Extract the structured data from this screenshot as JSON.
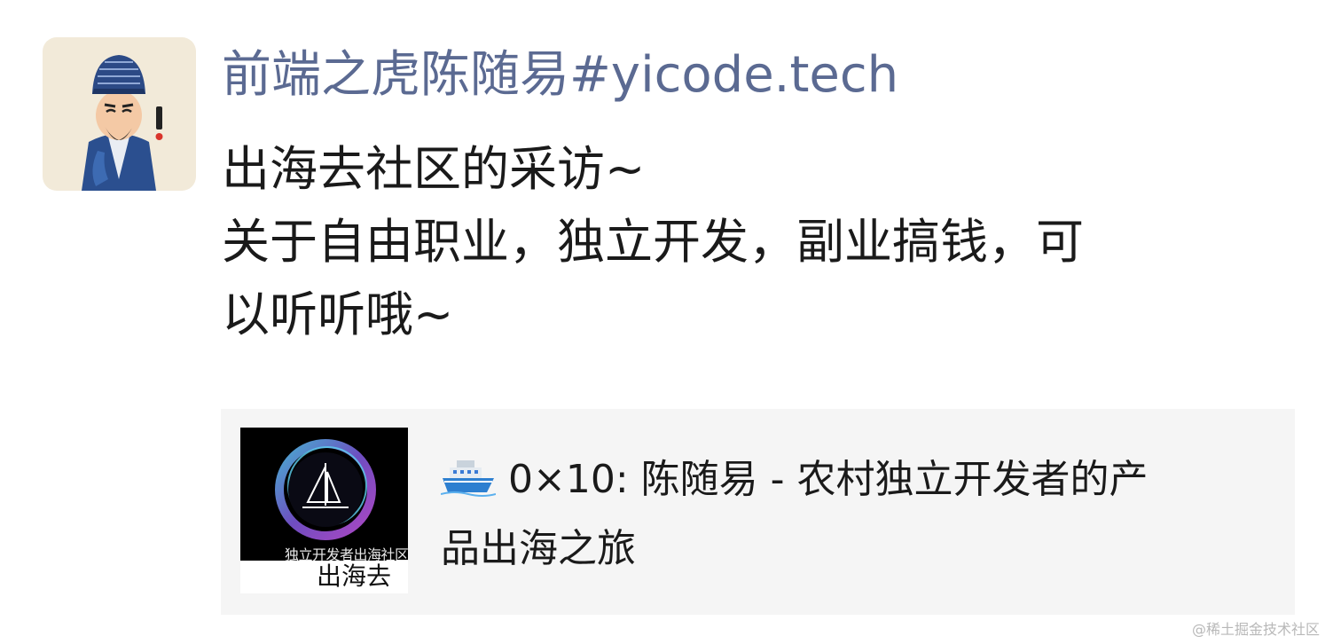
{
  "post": {
    "author": "前端之虎陈随易#yicode.tech",
    "avatar_icon": "cartoon-scholar-avatar",
    "message_lines": [
      "出海去社区的采访~",
      "关于自由职业，独立开发，副业搞钱，可",
      "以听听哦~"
    ]
  },
  "link_card": {
    "thumbnail": {
      "subtitle": "独立开发者出海社区",
      "label": "出海去",
      "icon": "sailboat-logo-icon"
    },
    "title_icon": "ship-emoji-icon",
    "title_lines": [
      "0×10: 陈随易 - 农村独立开发者的产",
      "品出海之旅"
    ]
  },
  "watermark": "@稀土掘金技术社区",
  "colors": {
    "author": "#5b6a92",
    "text": "#1a1a1a",
    "card_bg": "#f5f5f5",
    "avatar_bg": "#f2ead9"
  }
}
